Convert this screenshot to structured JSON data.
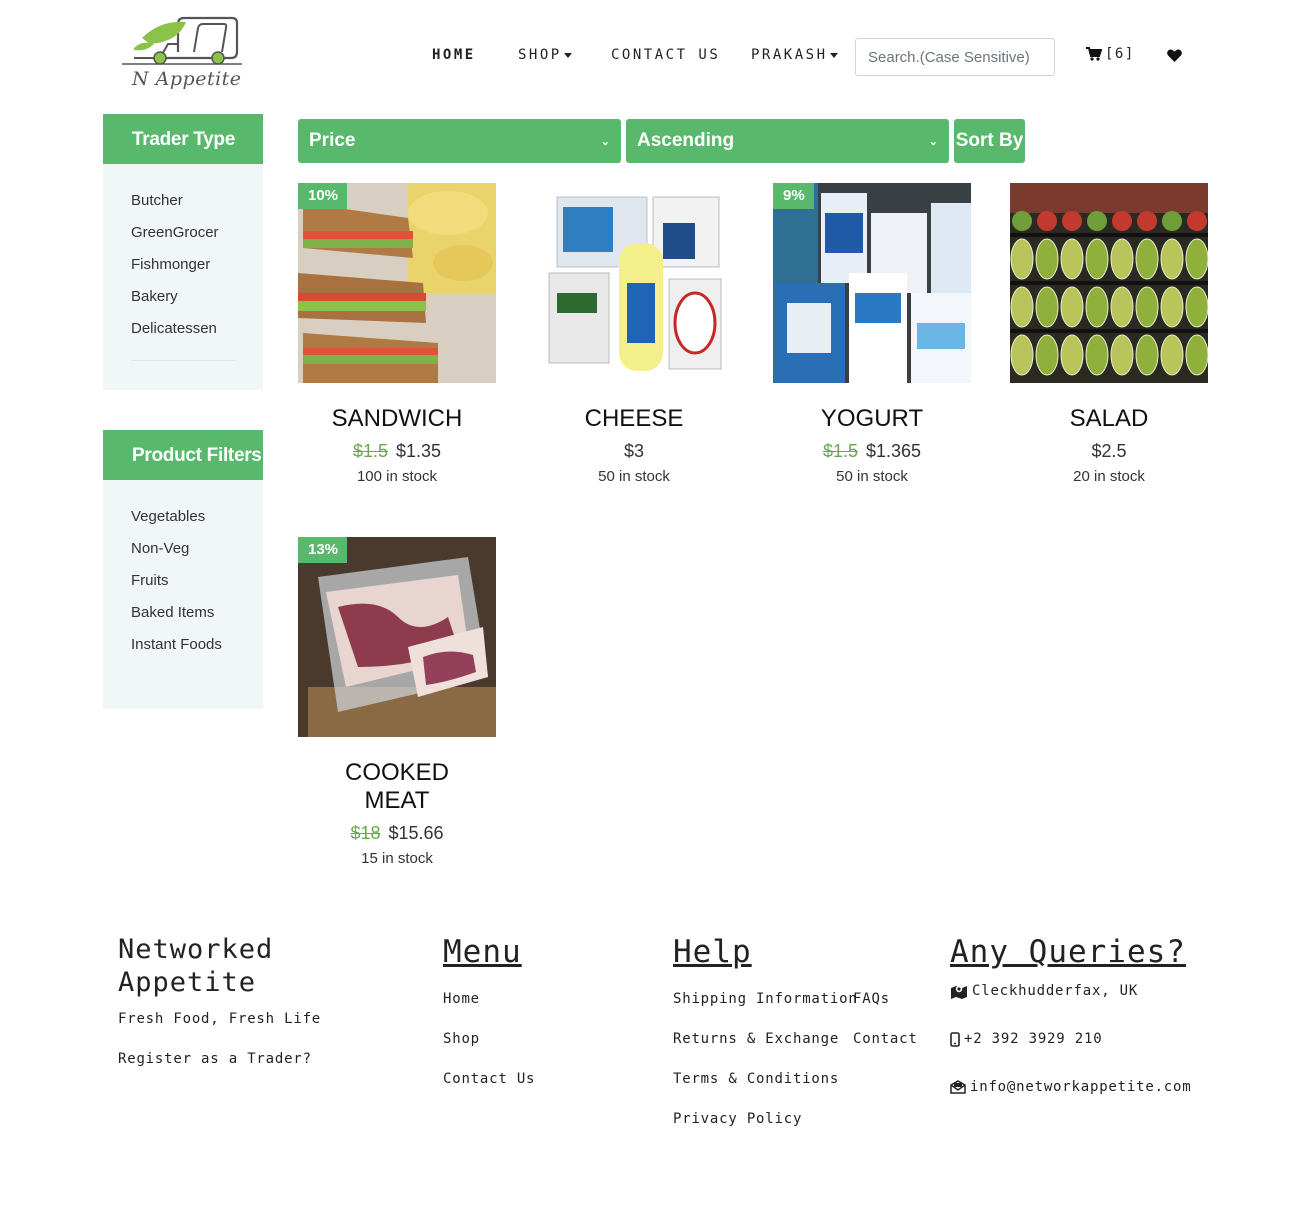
{
  "header": {
    "logo_text": "N Appetite",
    "nav": {
      "home": "HOME",
      "shop": "SHOP",
      "contact": "CONTACT US",
      "user": "PRAKASH"
    },
    "search_placeholder": "Search.(Case Sensitive)",
    "cart_label": "[6]"
  },
  "sidebar": {
    "trader_title": "Trader Type",
    "trader_types": [
      "Butcher",
      "GreenGrocer",
      "Fishmonger",
      "Bakery",
      "Delicatessen"
    ],
    "filter_title": "Product Filters",
    "filters": [
      "Vegetables",
      "Non-Veg",
      "Fruits",
      "Baked Items",
      "Instant Foods"
    ]
  },
  "sort": {
    "field": "Price",
    "order": "Ascending",
    "button": "Sort By"
  },
  "products": [
    {
      "name": "SANDWICH",
      "badge": "10%",
      "old_price": "$1.5",
      "price": "$1.35",
      "stock": "100 in stock"
    },
    {
      "name": "CHEESE",
      "badge": "",
      "old_price": "",
      "price": "$3",
      "stock": "50 in stock"
    },
    {
      "name": "YOGURT",
      "badge": "9%",
      "old_price": "$1.5",
      "price": "$1.365",
      "stock": "50 in stock"
    },
    {
      "name": "SALAD",
      "badge": "",
      "old_price": "",
      "price": "$2.5",
      "stock": "20 in stock"
    },
    {
      "name": "COOKED MEAT",
      "badge": "13%",
      "old_price": "$18",
      "price": "$15.66",
      "stock": "15 in stock"
    }
  ],
  "footer": {
    "brand_line1": "Networked",
    "brand_line2": "Appetite",
    "tagline": "Fresh Food, Fresh Life",
    "register": "Register as a Trader?",
    "menu_title": "Menu",
    "menu": [
      "Home",
      "Shop",
      "Contact Us"
    ],
    "help_title": "Help",
    "help_col1": [
      "Shipping Information",
      "Returns & Exchange",
      "Terms & Conditions",
      "Privacy Policy"
    ],
    "help_col2": [
      "FAQs",
      "Contact"
    ],
    "queries_title": "Any Queries?",
    "address": "Cleckhudderfax, UK",
    "phone": "+2 392 3929 210",
    "email": "info@networkappetite.com"
  },
  "colors": {
    "accent": "#58b86c",
    "sidebar_bg": "#f1f6f6",
    "strike": "#6aa84f"
  }
}
